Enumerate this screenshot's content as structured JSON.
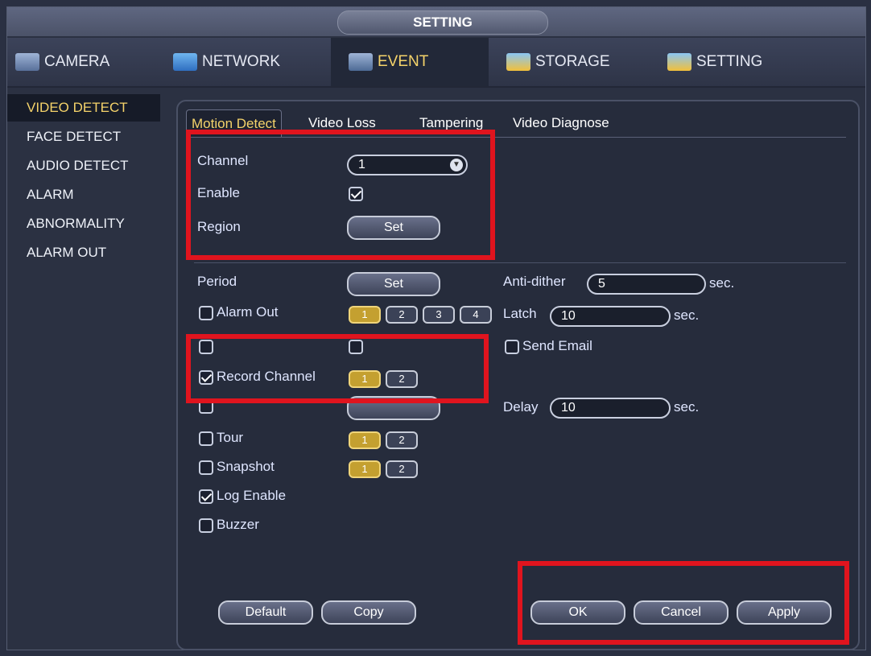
{
  "window": {
    "title": "SETTING"
  },
  "topnav": {
    "items": [
      {
        "label": "CAMERA",
        "icon": "camera-icon"
      },
      {
        "label": "NETWORK",
        "icon": "network-icon"
      },
      {
        "label": "EVENT",
        "icon": "event-icon"
      },
      {
        "label": "STORAGE",
        "icon": "storage-icon"
      },
      {
        "label": "SETTING",
        "icon": "setting-icon"
      }
    ],
    "active": "EVENT"
  },
  "sidebar": {
    "items": [
      {
        "label": "VIDEO DETECT"
      },
      {
        "label": "FACE DETECT"
      },
      {
        "label": "AUDIO DETECT"
      },
      {
        "label": "ALARM"
      },
      {
        "label": "ABNORMALITY"
      },
      {
        "label": "ALARM OUT"
      }
    ],
    "active": "VIDEO DETECT"
  },
  "tabs": [
    {
      "label": "Motion Detect"
    },
    {
      "label": "Video Loss"
    },
    {
      "label": "Tampering"
    },
    {
      "label": "Video Diagnose"
    }
  ],
  "form": {
    "channel_label": "Channel",
    "channel_value": "1",
    "enable_label": "Enable",
    "enable_checked": true,
    "region_label": "Region",
    "region_button": "Set",
    "period_label": "Period",
    "period_button": "Set",
    "anti_dither_label": "Anti-dither",
    "anti_dither_value": "5",
    "anti_dither_unit": "sec.",
    "alarm_out_label": "Alarm Out",
    "alarm_out_channels": [
      "1",
      "2",
      "3",
      "4"
    ],
    "latch_label": "Latch",
    "latch_value": "10",
    "latch_unit": "sec.",
    "send_email_label": "Send Email",
    "record_channel_label": "Record Channel",
    "record_channels": [
      "1",
      "2"
    ],
    "delay_label": "Delay",
    "delay_value": "10",
    "delay_unit": "sec.",
    "tour_label": "Tour",
    "tour_channels": [
      "1",
      "2"
    ],
    "snapshot_label": "Snapshot",
    "snapshot_channels": [
      "1",
      "2"
    ],
    "log_enable_label": "Log Enable",
    "buzzer_label": "Buzzer"
  },
  "buttons": {
    "default": "Default",
    "copy": "Copy",
    "ok": "OK",
    "cancel": "Cancel",
    "apply": "Apply"
  },
  "colors": {
    "accent": "#f5d36a",
    "highlight_box": "#e0141e",
    "active_channel": "#c4a030"
  }
}
